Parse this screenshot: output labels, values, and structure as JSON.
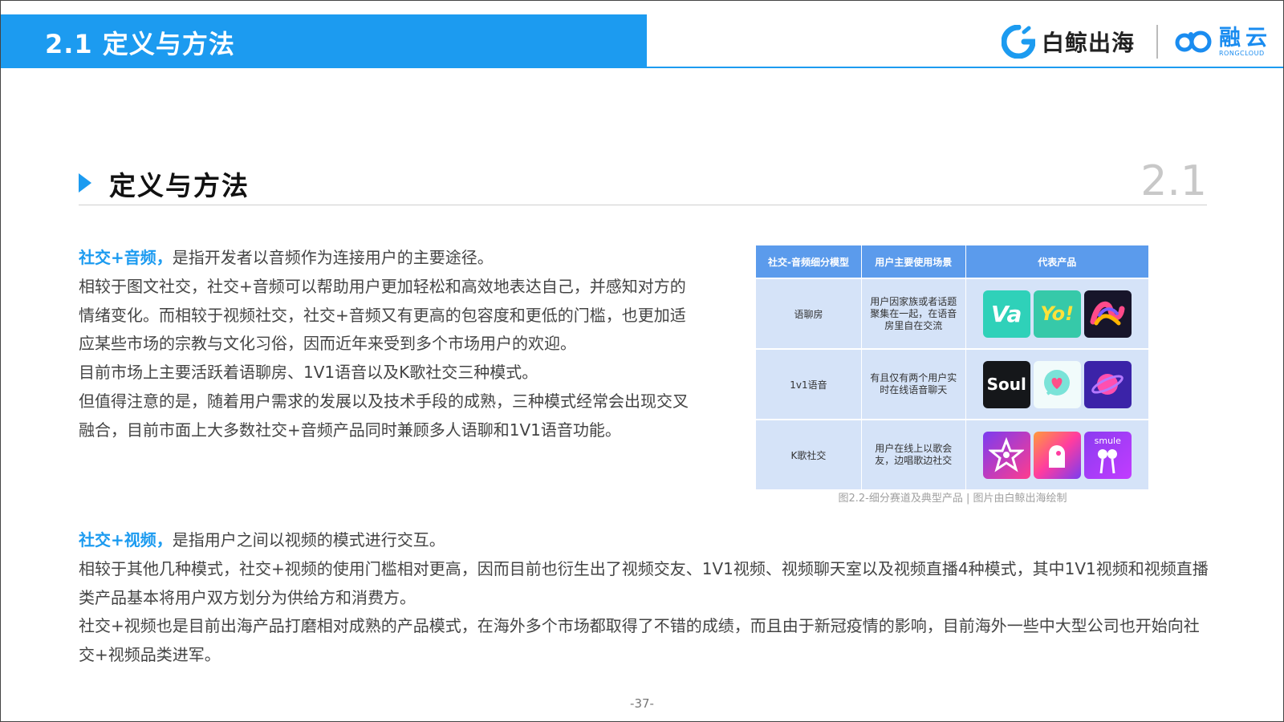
{
  "header": {
    "title": "2.1 定义与方法",
    "brand1": "白鲸出海",
    "brand2_cn": "融云",
    "brand2_en": "RONGCLOUD"
  },
  "section": {
    "title": "定义与方法",
    "number": "2.1"
  },
  "audio": {
    "lead": "社交+音频，",
    "line1": "是指开发者以音频作为连接用户的主要途径。",
    "line2": "相较于图文社交，社交+音频可以帮助用户更加轻松和高效地表达自己，并感知对方的情绪变化。而相较于视频社交，社交+音频又有更高的包容度和更低的门槛，也更加适应某些市场的宗教与文化习俗，因而近年来受到多个市场用户的欢迎。",
    "line3": "目前市场上主要活跃着语聊房、1V1语音以及K歌社交三种模式。",
    "line4": "但值得注意的是，随着用户需求的发展以及技术手段的成熟，三种模式经常会出现交叉融合，目前市面上大多数社交+音频产品同时兼顾多人语聊和1V1语音功能。"
  },
  "video": {
    "lead": "社交+视频，",
    "line1": "是指用户之间以视频的模式进行交互。",
    "line2": "相较于其他几种模式，社交+视频的使用门槛相对更高，因而目前也衍生出了视频交友、1V1视频、视频聊天室以及视频直播4种模式，其中1V1视频和视频直播类产品基本将用户双方划分为供给方和消费方。",
    "line3": "社交+视频也是目前出海产品打磨相对成熟的产品模式，在海外多个市场都取得了不错的成绩，而且由于新冠疫情的影响，目前海外一些中大型公司也开始向社交+视频品类进军。"
  },
  "table": {
    "headers": [
      "社交-音频细分模型",
      "用户主要使用场景",
      "代表产品"
    ],
    "rows": [
      {
        "model": "语聊房",
        "scene": "用户因家族或者话题聚集在一起，在语音房里自在交流",
        "apps": [
          "Va",
          "Yo!",
          "ribbon"
        ]
      },
      {
        "model": "1v1语音",
        "scene": "有且仅有两个用户实时在线语音聊天",
        "apps": [
          "Soul",
          "heart",
          "planet"
        ]
      },
      {
        "model": "K歌社交",
        "scene": "用户在线上以歌会友，边唱歌边社交",
        "apps": [
          "star",
          "bird",
          "smule"
        ]
      }
    ],
    "caption": "图2.2-细分赛道及典型产品 | 图片由白鲸出海绘制",
    "app_labels": {
      "va": "Va",
      "yo": "Yo!",
      "soul": "Soul",
      "smule": "smule"
    }
  },
  "footer": {
    "page": "-37-"
  },
  "colors": {
    "accent": "#1c9bf0",
    "table_header": "#5b9bec",
    "table_cell": "#d5e3f8"
  }
}
